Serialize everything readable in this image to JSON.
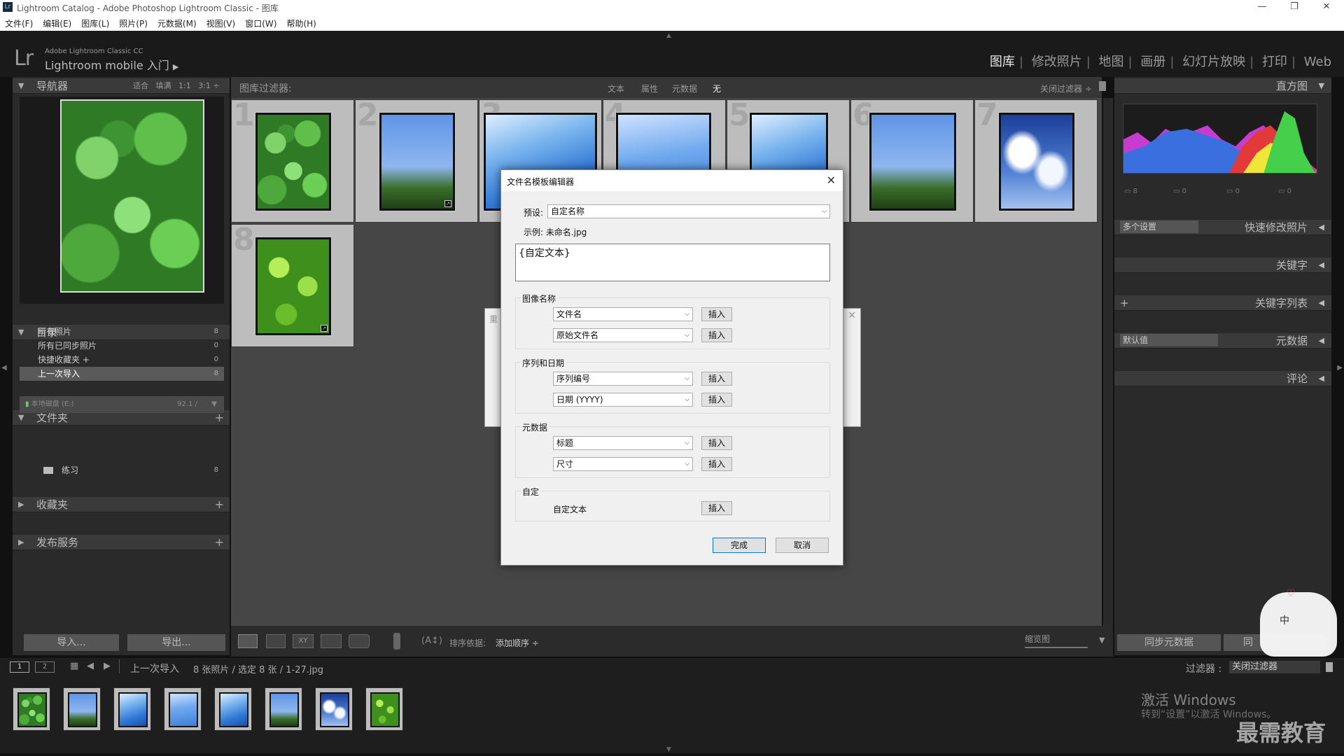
{
  "window": {
    "title": "Lightroom Catalog - Adobe Photoshop Lightroom Classic - 图库",
    "app_icon": "Lr"
  },
  "menu": [
    "文件(F)",
    "编辑(E)",
    "图库(L)",
    "照片(P)",
    "元数据(M)",
    "视图(V)",
    "窗口(W)",
    "帮助(H)"
  ],
  "identity": {
    "logo": "Lr",
    "line1": "Adobe Lightroom Classic CC",
    "line2": "Lightroom mobile 入门"
  },
  "modules": [
    "图库",
    "修改照片",
    "地图",
    "画册",
    "幻灯片放映",
    "打印",
    "Web"
  ],
  "active_module": "图库",
  "navigator": {
    "title": "导航器",
    "zoom": [
      "适合",
      "填满",
      "1:1",
      "3:1"
    ]
  },
  "catalog": {
    "title": "目录",
    "items": [
      {
        "label": "所有照片",
        "count": "8"
      },
      {
        "label": "所有已同步照片",
        "count": "0"
      },
      {
        "label": "快捷收藏夹 +",
        "count": "0"
      },
      {
        "label": "上一次导入",
        "count": "8"
      }
    ]
  },
  "folders": {
    "title": "文件夹",
    "volume": "本地磁盘 (E:)",
    "volume_space": "92.1 / ",
    "items": [
      {
        "label": "练习",
        "count": "8"
      }
    ]
  },
  "collections": {
    "title": "收藏夹"
  },
  "publish": {
    "title": "发布服务"
  },
  "left_buttons": {
    "import": "导入...",
    "export": "导出..."
  },
  "filter_bar": {
    "label": "图库过滤器:",
    "options": [
      "文本",
      "属性",
      "元数据",
      "无"
    ],
    "preset": "关闭过滤器 ÷"
  },
  "grid": {
    "numbers": [
      "1",
      "2",
      "3",
      "4",
      "5",
      "6",
      "7",
      "8"
    ]
  },
  "toolbar": {
    "sort_label": "排序依据:",
    "sort_value": "添加顺序 ÷",
    "thumb_label": "缩览图"
  },
  "right_panel": {
    "histogram": "直方图",
    "hist_stats": [
      "8",
      "0",
      "0",
      "0"
    ],
    "quick_develop": {
      "label": "快速修改照片",
      "select": "多个设置"
    },
    "keywording": "关键字",
    "keyword_list": "关键字列表",
    "metadata": {
      "label": "元数据",
      "select": "默认值"
    },
    "comments": "评论",
    "sync_metadata": "同步元数据",
    "sync_settings": "同"
  },
  "filmstrip_bar": {
    "pages": [
      "1",
      "2"
    ],
    "source": "上一次导入",
    "info": "8 张照片 / 选定 8 张 / 1-27.jpg",
    "filter_label": "过滤器 :",
    "filter_value": "关闭过滤器"
  },
  "dialog": {
    "title": "文件名模板编辑器",
    "preset_label": "预设:",
    "preset_value": "自定名称",
    "example_label": "示例: 未命名.jpg",
    "template_text": "{自定文本}",
    "groups": {
      "image_name": {
        "title": "图像名称",
        "rows": [
          {
            "value": "文件名",
            "btn": "插入"
          },
          {
            "value": "原始文件名",
            "btn": "插入"
          }
        ]
      },
      "sequence": {
        "title": "序列和日期",
        "rows": [
          {
            "value": "序列编号",
            "btn": "插入"
          },
          {
            "value": "日期 (YYYY)",
            "btn": "插入"
          }
        ]
      },
      "metadata": {
        "title": "元数据",
        "rows": [
          {
            "value": "标题",
            "btn": "插入"
          },
          {
            "value": "尺寸",
            "btn": "插入"
          }
        ]
      },
      "custom": {
        "title": "自定",
        "text": "自定文本",
        "btn": "插入"
      }
    },
    "done": "完成",
    "cancel": "取消"
  },
  "back_dialog_title_char": "重",
  "watermark": {
    "line1": "激活 Windows",
    "line2": "转到“设置”以激活 Windows。",
    "brand": "最需教育",
    "ime": "中"
  }
}
